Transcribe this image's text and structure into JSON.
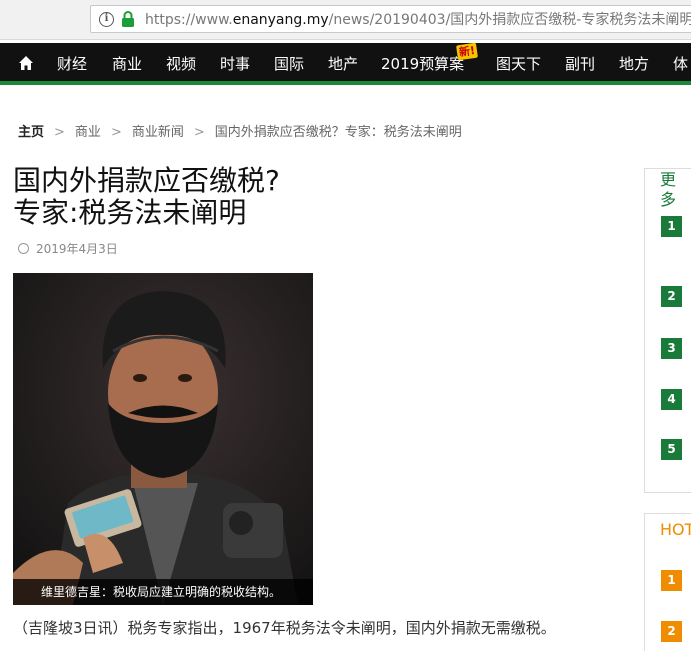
{
  "browser": {
    "url_prefix": "https://www.",
    "url_domain": "enanyang.my",
    "url_path": "/news/20190403/国内外捐款应否缴税-专家税务法未阐明/"
  },
  "nav": {
    "items": [
      "财经",
      "商业",
      "视频",
      "时事",
      "国际",
      "地产",
      "2019预算案",
      "图天下",
      "副刊",
      "地方",
      "体"
    ],
    "new_badge": "新!"
  },
  "breadcrumb": {
    "items": [
      "主页",
      "商业",
      "商业新闻",
      "国内外捐款应否缴税？专家：税务法未阐明"
    ]
  },
  "article": {
    "title_line1": "国内外捐款应否缴税?",
    "title_line2": "专家:税务法未阐明",
    "date": "2019年4月3日",
    "photo_caption": "维里德吉星：税收局应建立明确的税收结构。",
    "lede": "（吉隆坡3日讯）税务专家指出，1967年税务法令未阐明，国内外捐款无需缴税。"
  },
  "sidebar": {
    "more_title": "更多",
    "more_numbers": [
      "1",
      "2",
      "3",
      "4",
      "5"
    ],
    "hot_title": "HOT",
    "hot_numbers": [
      "1",
      "2"
    ]
  },
  "colors": {
    "brand_green": "#1a7a3a",
    "hot_orange": "#f08c00",
    "nav_bg": "#111111"
  }
}
